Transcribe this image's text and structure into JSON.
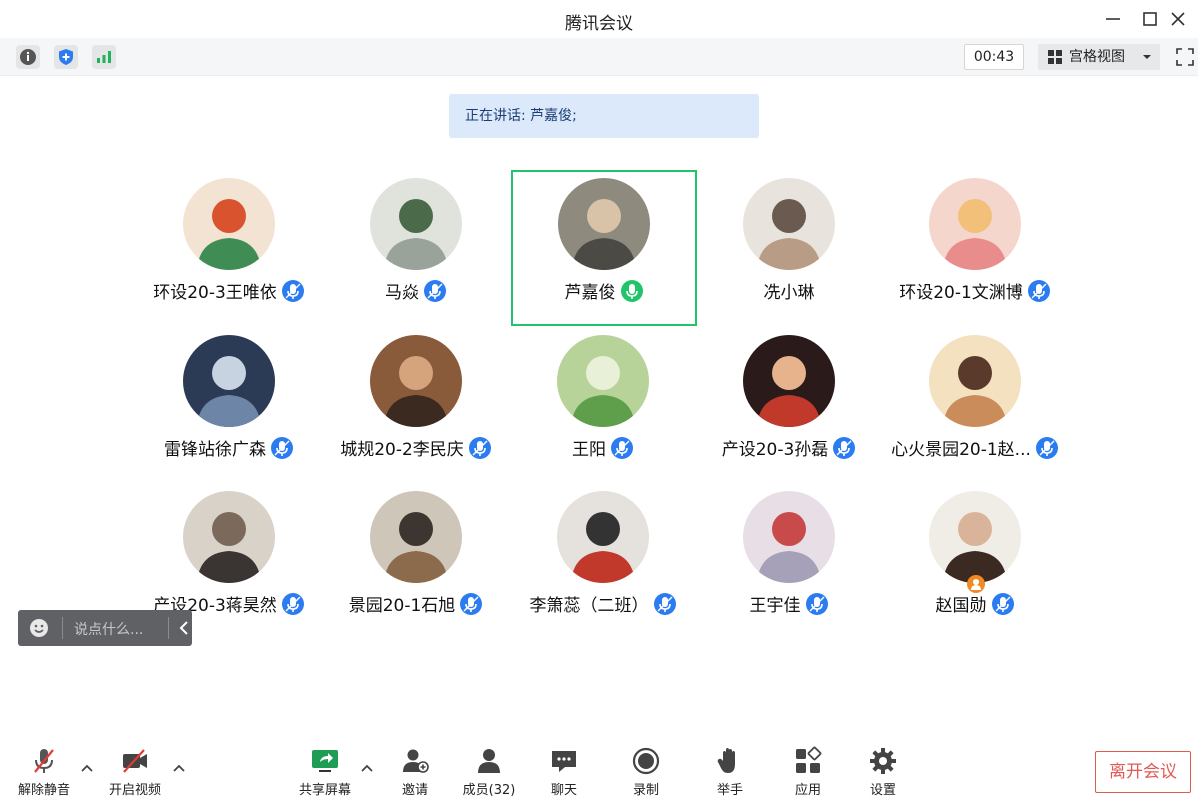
{
  "window": {
    "title": "腾讯会议"
  },
  "toolbar": {
    "info_icon": "info-icon",
    "security_icon": "shield-icon",
    "signal_icon": "signal-icon",
    "timer": "00:43",
    "view_mode_label": "宫格视图"
  },
  "speaking_banner": "正在讲话: 芦嘉俊;",
  "participants": [
    {
      "name": "环设20-3王唯依",
      "speaking": false
    },
    {
      "name": "马焱",
      "speaking": false
    },
    {
      "name": "芦嘉俊",
      "speaking": true
    },
    {
      "name": "冼小琳",
      "speaking": false
    },
    {
      "name": "环设20-1文渊博",
      "speaking": false
    },
    {
      "name": "雷锋站徐广森",
      "speaking": false
    },
    {
      "name": "城规20-2李民庆",
      "speaking": false
    },
    {
      "name": "王阳",
      "speaking": false
    },
    {
      "name": "产设20-3孙磊",
      "speaking": false
    },
    {
      "name": "心火景园20-1赵...",
      "speaking": false
    },
    {
      "name": "产设20-3蒋昊然",
      "speaking": false
    },
    {
      "name": "景园20-1石旭",
      "speaking": false
    },
    {
      "name": "李箫蕊（二班）",
      "speaking": false
    },
    {
      "name": "王宇佳",
      "speaking": false
    },
    {
      "name": "赵国勋",
      "speaking": false,
      "host": true
    }
  ],
  "chat": {
    "placeholder": "说点什么..."
  },
  "bottom": {
    "unmute": "解除静音",
    "start_video": "开启视频",
    "share_screen": "共享屏幕",
    "invite": "邀请",
    "members": "成员(32)",
    "chat": "聊天",
    "record": "录制",
    "raise_hand": "举手",
    "apps": "应用",
    "settings": "设置",
    "leave": "离开会议"
  },
  "colors": {
    "accent": "#2b7cf0",
    "speaking": "#22c46b",
    "danger": "#e05a54"
  }
}
